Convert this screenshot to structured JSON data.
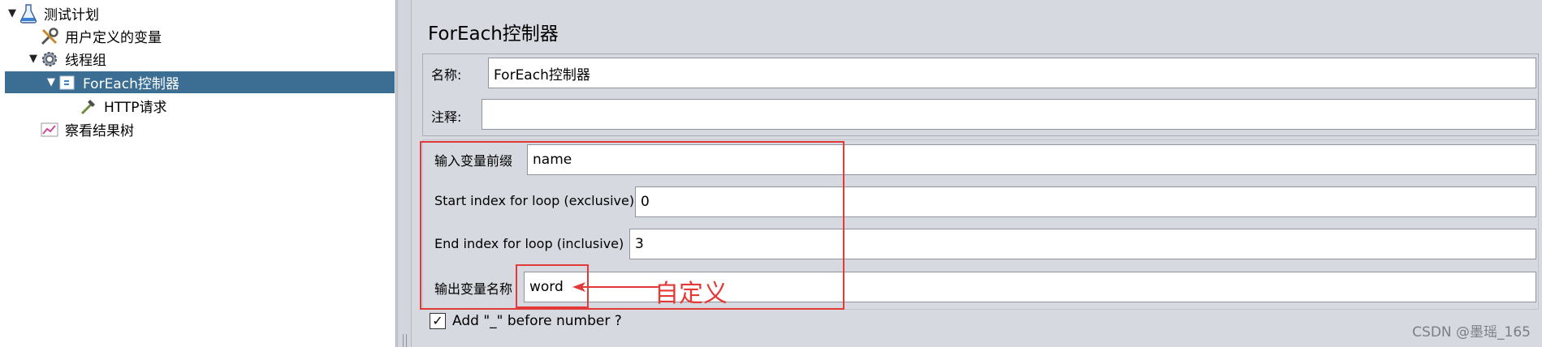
{
  "tree": {
    "items": [
      {
        "label": "测试计划",
        "icon": "beaker-icon",
        "toggle": "▼"
      },
      {
        "label": "用户定义的变量",
        "icon": "wrench-icon",
        "toggle": ""
      },
      {
        "label": "线程组",
        "icon": "gear-icon",
        "toggle": "▼"
      },
      {
        "label": "ForEach控制器",
        "icon": "foreach-controller-icon",
        "toggle": "▼"
      },
      {
        "label": "HTTP请求",
        "icon": "dropper-icon",
        "toggle": ""
      },
      {
        "label": "察看结果树",
        "icon": "chart-icon",
        "toggle": ""
      }
    ]
  },
  "panel": {
    "title": "ForEach控制器",
    "name_label": "名称:",
    "name_value": "ForEach控制器",
    "comment_label": "注释:",
    "comment_value": "",
    "input_prefix_label": "输入变量前缀",
    "input_prefix_value": "name",
    "start_label": "Start index for loop (exclusive)",
    "start_value": "0",
    "end_label": "End index for loop (inclusive)",
    "end_value": "3",
    "output_label": "输出变量名称",
    "output_value": "word",
    "checkbox_label": "Add \"_\" before number ?",
    "checkbox_checked": "✓"
  },
  "annotation": {
    "text": "自定义",
    "color": "#e23a36"
  },
  "watermark": "CSDN @墨瑶_165",
  "colors": {
    "selection": "#3c6e93",
    "panel_bg": "#d6d9df",
    "highlight": "#e23a36"
  }
}
